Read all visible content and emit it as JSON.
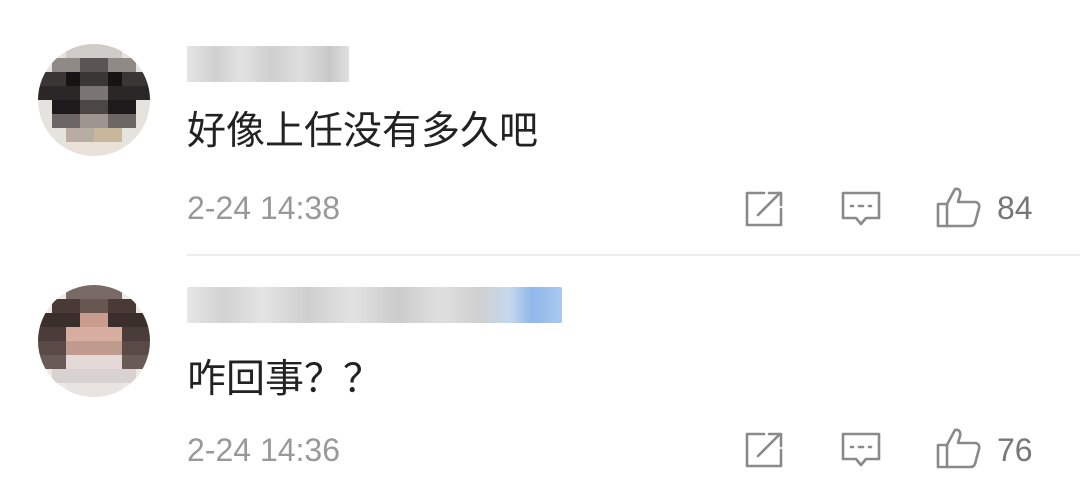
{
  "comments": [
    {
      "username": "",
      "text": "好像上任没有多久吧",
      "time": "2-24 14:38",
      "like_count": "84",
      "icons": [
        "share-icon",
        "reply-icon",
        "thumbs-up-icon"
      ]
    },
    {
      "username": "",
      "text": "咋回事？？",
      "time": "2-24 14:36",
      "like_count": "76",
      "icons": [
        "share-icon",
        "reply-icon",
        "thumbs-up-icon"
      ]
    }
  ],
  "colors": {
    "text": "#222222",
    "meta": "#999999",
    "icon": "#8a8a8a",
    "divider": "#eeeeee",
    "vip_badge": "#8fb8ea"
  }
}
